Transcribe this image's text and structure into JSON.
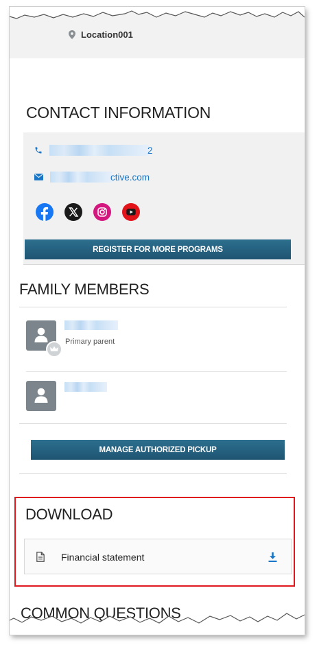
{
  "header": {
    "location": "Location001"
  },
  "contact": {
    "title": "CONTACT INFORMATION",
    "phone_tail": "2",
    "email_tail": "ctive.com",
    "social": [
      "facebook",
      "x-twitter",
      "instagram",
      "youtube"
    ],
    "register_button": "REGISTER FOR MORE PROGRAMS"
  },
  "family": {
    "title": "FAMILY MEMBERS",
    "members": [
      {
        "role": "Primary parent"
      },
      {
        "role": ""
      }
    ],
    "manage_button": "MANAGE AUTHORIZED PICKUP"
  },
  "download": {
    "title": "DOWNLOAD",
    "items": [
      {
        "label": "Financial statement"
      }
    ]
  },
  "questions": {
    "title": "COMMON QUESTIONS"
  },
  "colors": {
    "link": "#1976c6",
    "button": "#22597a",
    "highlight": "#e0171d",
    "facebook": "#1877f2",
    "instagram": "#d3177f",
    "youtube": "#e3131a"
  }
}
